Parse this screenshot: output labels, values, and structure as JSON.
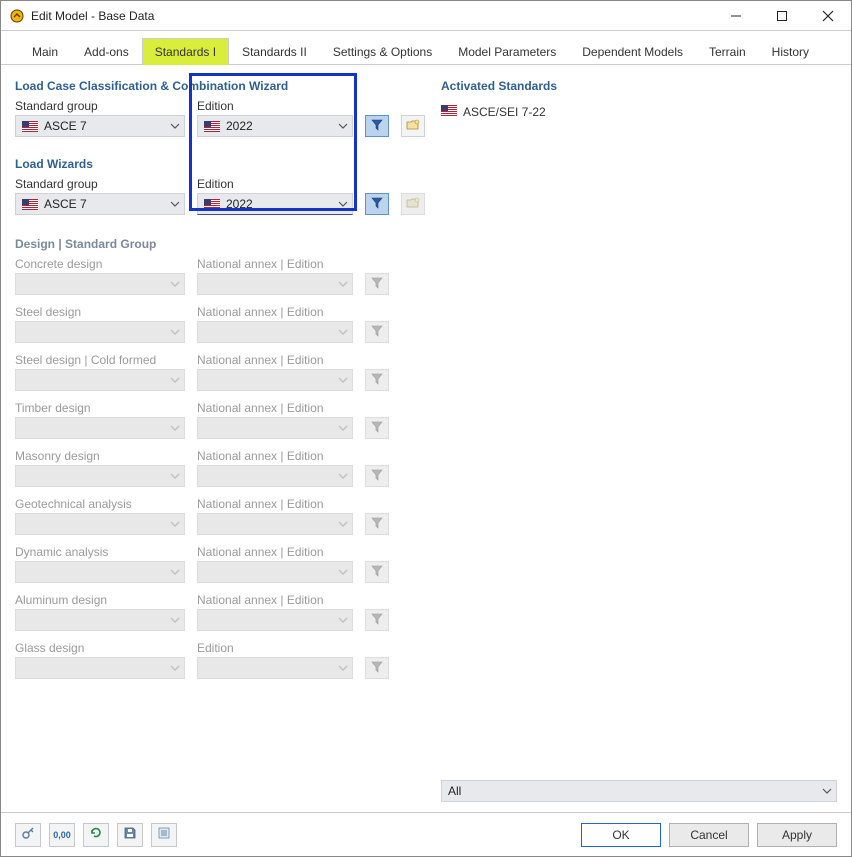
{
  "window_title": "Edit Model - Base Data",
  "tabs": [
    "Main",
    "Add-ons",
    "Standards I",
    "Standards II",
    "Settings & Options",
    "Model Parameters",
    "Dependent Models",
    "Terrain",
    "History"
  ],
  "active_tab_index": 2,
  "sections": {
    "load_case": {
      "title": "Load Case Classification & Combination Wizard",
      "standard_group_label": "Standard group",
      "standard_group_value": "ASCE 7",
      "edition_label": "Edition",
      "edition_value": "2022"
    },
    "load_wizards": {
      "title": "Load Wizards",
      "standard_group_label": "Standard group",
      "standard_group_value": "ASCE 7",
      "edition_label": "Edition",
      "edition_value": "2022"
    },
    "design_group": {
      "title": "Design | Standard Group",
      "rows": [
        {
          "left_label": "Concrete design",
          "right_label": "National annex | Edition"
        },
        {
          "left_label": "Steel design",
          "right_label": "National annex | Edition"
        },
        {
          "left_label": "Steel design | Cold formed",
          "right_label": "National annex | Edition"
        },
        {
          "left_label": "Timber design",
          "right_label": "National annex | Edition"
        },
        {
          "left_label": "Masonry design",
          "right_label": "National annex | Edition"
        },
        {
          "left_label": "Geotechnical analysis",
          "right_label": "National annex | Edition"
        },
        {
          "left_label": "Dynamic analysis",
          "right_label": "National annex | Edition"
        },
        {
          "left_label": "Aluminum design",
          "right_label": "National annex | Edition"
        },
        {
          "left_label": "Glass design",
          "right_label": "Edition"
        }
      ]
    }
  },
  "activated": {
    "title": "Activated Standards",
    "items": [
      "ASCE/SEI 7-22"
    ],
    "filter_value": "All"
  },
  "buttons": {
    "ok": "OK",
    "cancel": "Cancel",
    "apply": "Apply"
  }
}
